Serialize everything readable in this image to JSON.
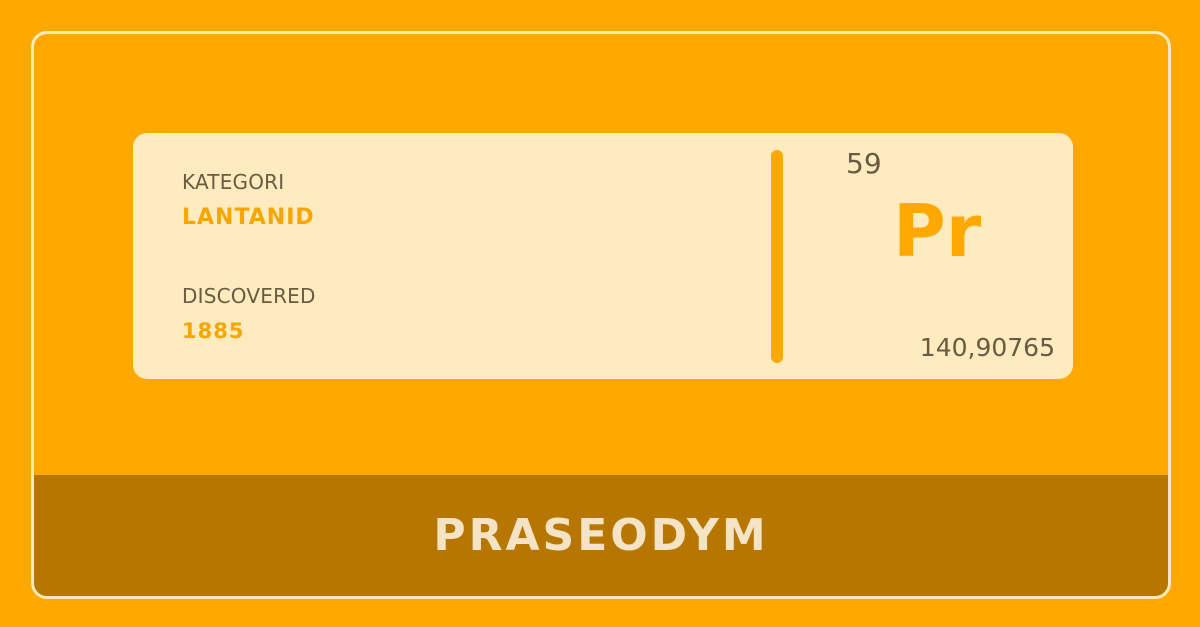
{
  "card": {
    "category_label": "KATEGORI",
    "category_value": "LANTANID",
    "discovered_label": "DISCOVERED",
    "discovered_value": "1885",
    "atomic_number": "59",
    "symbol": "Pr",
    "atomic_mass": "140,90765"
  },
  "name_bar": {
    "element_name": "PRASEODYM"
  },
  "colors": {
    "background": "#FFA800",
    "card_background": "#FFEBC0",
    "accent_text": "#F7A600",
    "name_bar_background": "#B77600",
    "name_text": "#F4E3C4"
  }
}
